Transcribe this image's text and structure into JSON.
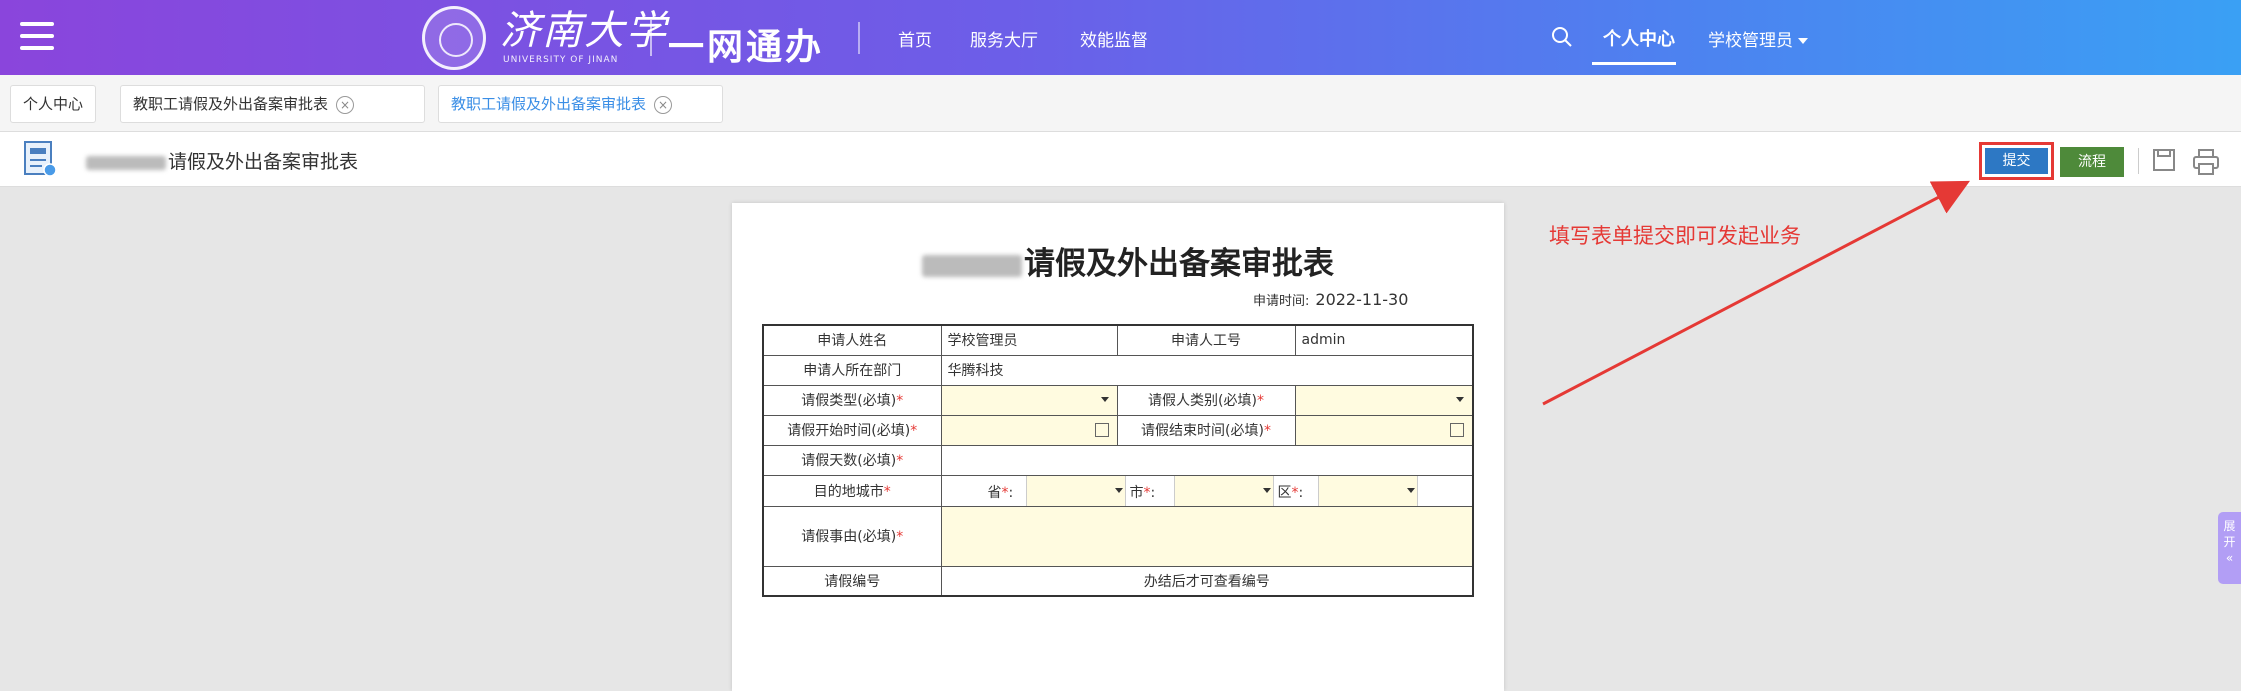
{
  "header": {
    "university_name": "济南大学",
    "university_sub": "UNIVERSITY OF JINAN",
    "product_name": "一网通办",
    "nav": [
      "首页",
      "服务大厅",
      "效能监督"
    ],
    "tabs": [
      "个人中心"
    ],
    "user_menu": "学校管理员",
    "colors": {
      "gradient_start": "#8a45dc",
      "gradient_end": "#3aa0f4"
    }
  },
  "page_tabs": [
    {
      "label": "个人中心"
    },
    {
      "label": "教职工请假及外出备案审批表"
    },
    {
      "label": "教职工请假及外出备案审批表"
    }
  ],
  "toolbar": {
    "title": "请假及外出备案审批表",
    "submit_label": "提交",
    "flow_label": "流程"
  },
  "form": {
    "title": "请假及外出备案审批表",
    "apply_time_label": "申请时间:",
    "apply_time": "2022-11-30",
    "rows": {
      "applicant_name_label": "申请人姓名",
      "applicant_name": "学校管理员",
      "applicant_id_label": "申请人工号",
      "applicant_id": "admin",
      "department_label": "申请人所在部门",
      "department": "华腾科技",
      "leave_type_label": "请假类型(必填)",
      "applicant_category_label": "请假人类别(必填)",
      "start_time_label": "请假开始时间(必填)",
      "end_time_label": "请假结束时间(必填)",
      "days_label": "请假天数(必填)",
      "destination_label": "目的地城市",
      "province_label": "省",
      "city_label": "市",
      "district_label": "区",
      "reason_label": "请假事由(必填)",
      "number_label": "请假编号",
      "number_hint": "办结后才可查看编号"
    }
  },
  "annotation": "填写表单提交即可发起业务",
  "side_expand": "展开"
}
